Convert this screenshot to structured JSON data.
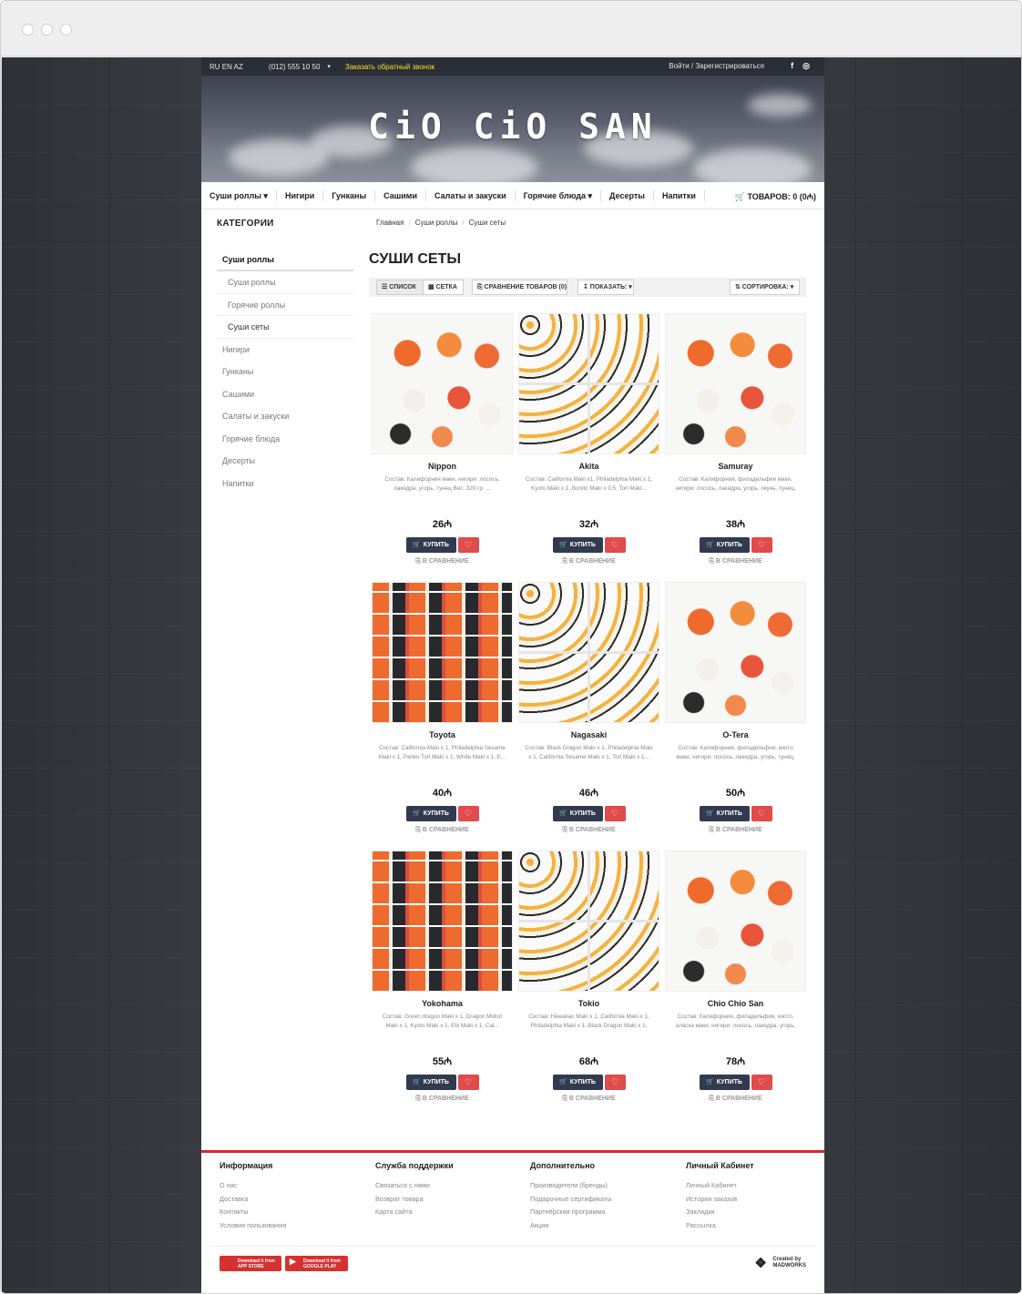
{
  "topbar": {
    "langs": "RU EN AZ",
    "phone": "(012) 555 10 50",
    "caret": "▾",
    "callback": "Заказать обратный звонок",
    "login": "Войти / Зарегистрироваться",
    "facebook_icon": "f",
    "instagram_icon": "◎"
  },
  "header": {
    "logo": "CiO CiO SAN"
  },
  "nav": {
    "items": [
      "Суши роллы ▾",
      "Нигири",
      "Гунканы",
      "Сашими",
      "Салаты и закуски",
      "Горячие блюда ▾",
      "Десерты",
      "Напитки"
    ],
    "cart_label": "ТОВАРОВ: 0 (0₼)",
    "cart_icon": "🛒"
  },
  "sidebar": {
    "title": "КАТЕГОРИИ",
    "items": [
      "Суши роллы",
      "Суши роллы",
      "Горячие роллы",
      "Суши сеты",
      "Нигири",
      "Гунканы",
      "Сашими",
      "Салаты и закуски",
      "Горячие блюда",
      "Десерты",
      "Напитки"
    ]
  },
  "breadcrumb": [
    "Главная",
    "Суши роллы",
    "Суши сеты"
  ],
  "page_title": "СУШИ СЕТЫ",
  "toolbar": {
    "list": "☰ СПИСОК",
    "grid": "▦ СЕТКА",
    "compare": "⎘ СРАВНЕНИЕ ТОВАРОВ (0)",
    "show": "↧ ПОКАЗАТЬ: ▾",
    "sort": "⇅ СОРТИРОВКА: ▾"
  },
  "product_actions": {
    "buy": "КУПИТЬ",
    "wish_icon": "♡",
    "compare": "В СРАВНЕНИЕ",
    "compare_icon": "⎘"
  },
  "products": [
    {
      "name": "Nippon",
      "desc": "Состав: Калифорния маки, нигири: лосось, лакедра, угорь, тунец Вес: 320 гр. ...",
      "price": "26₼"
    },
    {
      "name": "Akita",
      "desc": "Состав: California Maki x1, Philadelphia Maki x 1, Kyoto Maki x 1, Bonito Maki x 0.5, Tori Maki...",
      "price": "32₼"
    },
    {
      "name": "Samuray",
      "desc": "Состав: Калифорния, филадельфия маки, нигири: лосось, лакедра, угорь, окунь, тунец, креветка ...",
      "price": "38₼"
    },
    {
      "name": "Toyota",
      "desc": "Состав: California Maki x 1, Philadelphia Sesame Maki x 1, Panko Tori Maki x 1, White Maki x 1, E...",
      "price": "40₼"
    },
    {
      "name": "Nagasaki",
      "desc": "Состав: Black Dragon Maki x 1, Philadelphia Maki x 1, California Sesame Maki x 1, Tori Maki x 1...",
      "price": "46₼"
    },
    {
      "name": "O-Tera",
      "desc": "Состав: Калифорния, филадельфия, киото маки, нигири: лосось, лакедра, угорь, тунец, креветка, о...",
      "price": "50₼"
    },
    {
      "name": "Yokohama",
      "desc": "Состав: Green dragon Maki x 1, Dragon Midori Maki x 1, Kyoto Maki x 1, Ebi Maki x 1, Cal...",
      "price": "55₼"
    },
    {
      "name": "Tokio",
      "desc": "Состав: Hawaiian Maki x 1, California Maki x 1, Philadelphia Maki x 1, Black Dragon Maki x 1, Black...",
      "price": "68₼"
    },
    {
      "name": "Chio Chio San",
      "desc": "Состав: Калифорния, филадельфия, киото, аляска маки; нигири: лосось, лакедра, угорь, тунец, кр...",
      "price": "78₼"
    }
  ],
  "footer": {
    "columns": [
      {
        "title": "Информация",
        "links": [
          "О нас",
          "Доставка",
          "Контакты",
          "Условия пользования"
        ]
      },
      {
        "title": "Служба поддержки",
        "links": [
          "Связаться с нами",
          "Возврат товара",
          "Карта сайта"
        ]
      },
      {
        "title": "Дополнительно",
        "links": [
          "Производители (бренды)",
          "Подарочные сертификаты",
          "Партнёрская программа",
          "Акции"
        ]
      },
      {
        "title": "Личный Кабинет",
        "links": [
          "Личный Кабинет",
          "История заказов",
          "Закладки",
          "Рассылка"
        ]
      }
    ],
    "app_store": {
      "line1": "Download it from",
      "line2": "APP STORE",
      "icon": ""
    },
    "google_play": {
      "line1": "Download it from",
      "line2": "GOOGLE PLAY",
      "icon": "▶"
    },
    "credit": {
      "line1": "Created by",
      "line2": "MADWORKS",
      "icon": "❖"
    }
  }
}
